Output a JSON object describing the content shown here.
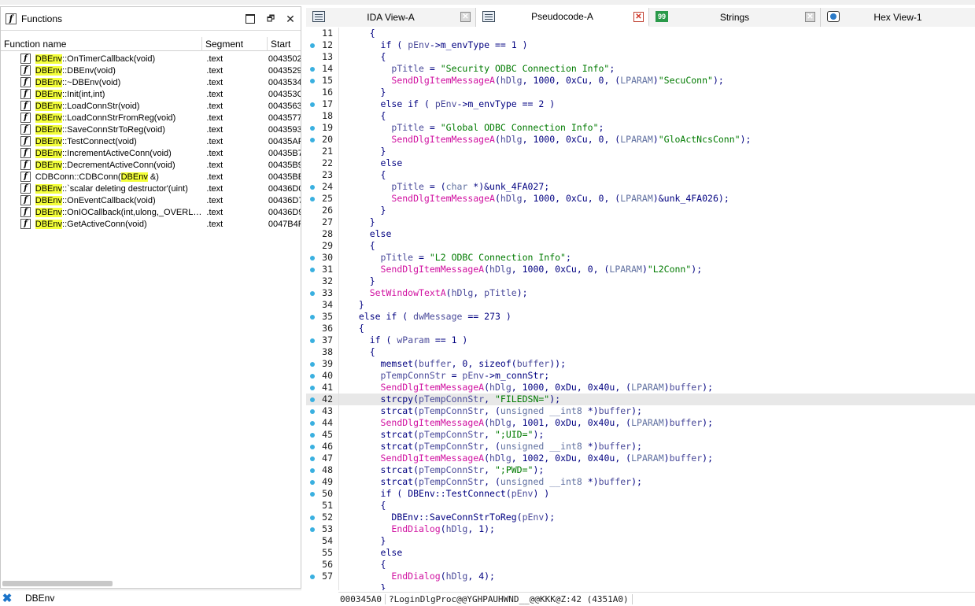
{
  "functions_pane": {
    "title": "Functions",
    "columns": {
      "name": "Function name",
      "segment": "Segment",
      "start": "Start"
    },
    "rows": [
      {
        "pre": "",
        "hl": "DBEnv",
        "post": "::OnTimerCallback(void)",
        "segment": ".text",
        "start": "0043502"
      },
      {
        "pre": "",
        "hl": "DBEnv",
        "post": "::DBEnv(void)",
        "segment": ".text",
        "start": "0043529"
      },
      {
        "pre": "",
        "hl": "DBEnv",
        "post": "::~DBEnv(void)",
        "segment": ".text",
        "start": "0043534"
      },
      {
        "pre": "",
        "hl": "DBEnv",
        "post": "::Init(int,int)",
        "segment": ".text",
        "start": "004353C"
      },
      {
        "pre": "",
        "hl": "DBEnv",
        "post": "::LoadConnStr(void)",
        "segment": ".text",
        "start": "0043563"
      },
      {
        "pre": "",
        "hl": "DBEnv",
        "post": "::LoadConnStrFromReg(void)",
        "segment": ".text",
        "start": "0043577"
      },
      {
        "pre": "",
        "hl": "DBEnv",
        "post": "::SaveConnStrToReg(void)",
        "segment": ".text",
        "start": "0043593"
      },
      {
        "pre": "",
        "hl": "DBEnv",
        "post": "::TestConnect(void)",
        "segment": ".text",
        "start": "00435AF"
      },
      {
        "pre": "",
        "hl": "DBEnv",
        "post": "::IncrementActiveConn(void)",
        "segment": ".text",
        "start": "00435B7"
      },
      {
        "pre": "",
        "hl": "DBEnv",
        "post": "::DecrementActiveConn(void)",
        "segment": ".text",
        "start": "00435B9"
      },
      {
        "pre": "CDBConn::CDBConn(",
        "hl": "DBEnv",
        "post": " &)",
        "segment": ".text",
        "start": "00435BE"
      },
      {
        "pre": "",
        "hl": "DBEnv",
        "post": "::`scalar deleting destructor'(uint)",
        "segment": ".text",
        "start": "00436D0"
      },
      {
        "pre": "",
        "hl": "DBEnv",
        "post": "::OnEventCallback(void)",
        "segment": ".text",
        "start": "00436D7"
      },
      {
        "pre": "",
        "hl": "DBEnv",
        "post": "::OnIOCallback(int,ulong,_OVERLAPPED *)",
        "segment": ".text",
        "start": "00436D9"
      },
      {
        "pre": "",
        "hl": "DBEnv",
        "post": "::GetActiveConn(void)",
        "segment": ".text",
        "start": "0047B4F"
      }
    ],
    "filter_text": "DBEnv"
  },
  "tabs": [
    {
      "label": "IDA View-A",
      "icon": "disassembly-view-icon",
      "active": false
    },
    {
      "label": "Pseudocode-A",
      "icon": "pseudocode-view-icon",
      "active": true
    },
    {
      "label": "Strings",
      "icon": "strings-view-icon",
      "active": false
    },
    {
      "label": "Hex View-1",
      "icon": "hex-view-icon",
      "active": false
    }
  ],
  "code": {
    "first_line": 11,
    "current_line": 42,
    "lines": [
      {
        "no": "11",
        "dot": false,
        "text": "    {"
      },
      {
        "no": "12",
        "dot": true,
        "text": "      if ( pEnv->m_envType == 1 )"
      },
      {
        "no": "13",
        "dot": false,
        "text": "      {"
      },
      {
        "no": "14",
        "dot": true,
        "text": "        pTitle = \"Security ODBC Connection Info\";"
      },
      {
        "no": "15",
        "dot": true,
        "text": "        SendDlgItemMessageA(hDlg, 1000, 0xCu, 0, (LPARAM)\"SecuConn\");"
      },
      {
        "no": "16",
        "dot": false,
        "text": "      }"
      },
      {
        "no": "17",
        "dot": true,
        "text": "      else if ( pEnv->m_envType == 2 )"
      },
      {
        "no": "18",
        "dot": false,
        "text": "      {"
      },
      {
        "no": "19",
        "dot": true,
        "text": "        pTitle = \"Global ODBC Connection Info\";"
      },
      {
        "no": "20",
        "dot": true,
        "text": "        SendDlgItemMessageA(hDlg, 1000, 0xCu, 0, (LPARAM)\"GloActNcsConn\");"
      },
      {
        "no": "21",
        "dot": false,
        "text": "      }"
      },
      {
        "no": "22",
        "dot": false,
        "text": "      else"
      },
      {
        "no": "23",
        "dot": false,
        "text": "      {"
      },
      {
        "no": "24",
        "dot": true,
        "text": "        pTitle = (char *)&unk_4FA027;"
      },
      {
        "no": "25",
        "dot": true,
        "text": "        SendDlgItemMessageA(hDlg, 1000, 0xCu, 0, (LPARAM)&unk_4FA026);"
      },
      {
        "no": "26",
        "dot": false,
        "text": "      }"
      },
      {
        "no": "27",
        "dot": false,
        "text": "    }"
      },
      {
        "no": "28",
        "dot": false,
        "text": "    else"
      },
      {
        "no": "29",
        "dot": false,
        "text": "    {"
      },
      {
        "no": "30",
        "dot": true,
        "text": "      pTitle = \"L2 ODBC Connection Info\";"
      },
      {
        "no": "31",
        "dot": true,
        "text": "      SendDlgItemMessageA(hDlg, 1000, 0xCu, 0, (LPARAM)\"L2Conn\");"
      },
      {
        "no": "32",
        "dot": false,
        "text": "    }"
      },
      {
        "no": "33",
        "dot": true,
        "text": "    SetWindowTextA(hDlg, pTitle);"
      },
      {
        "no": "34",
        "dot": false,
        "text": "  }"
      },
      {
        "no": "35",
        "dot": true,
        "text": "  else if ( dwMessage == 273 )"
      },
      {
        "no": "36",
        "dot": false,
        "text": "  {"
      },
      {
        "no": "37",
        "dot": true,
        "text": "    if ( wParam == 1 )"
      },
      {
        "no": "38",
        "dot": false,
        "text": "    {"
      },
      {
        "no": "39",
        "dot": true,
        "text": "      memset(buffer, 0, sizeof(buffer));"
      },
      {
        "no": "40",
        "dot": true,
        "text": "      pTempConnStr = pEnv->m_connStr;"
      },
      {
        "no": "41",
        "dot": true,
        "text": "      SendDlgItemMessageA(hDlg, 1000, 0xDu, 0x40u, (LPARAM)buffer);"
      },
      {
        "no": "42",
        "dot": true,
        "text": "      strcpy(pTempConnStr, \"FILEDSN=\");"
      },
      {
        "no": "43",
        "dot": true,
        "text": "      strcat(pTempConnStr, (unsigned __int8 *)buffer);"
      },
      {
        "no": "44",
        "dot": true,
        "text": "      SendDlgItemMessageA(hDlg, 1001, 0xDu, 0x40u, (LPARAM)buffer);"
      },
      {
        "no": "45",
        "dot": true,
        "text": "      strcat(pTempConnStr, \";UID=\");"
      },
      {
        "no": "46",
        "dot": true,
        "text": "      strcat(pTempConnStr, (unsigned __int8 *)buffer);"
      },
      {
        "no": "47",
        "dot": true,
        "text": "      SendDlgItemMessageA(hDlg, 1002, 0xDu, 0x40u, (LPARAM)buffer);"
      },
      {
        "no": "48",
        "dot": true,
        "text": "      strcat(pTempConnStr, \";PWD=\");"
      },
      {
        "no": "49",
        "dot": true,
        "text": "      strcat(pTempConnStr, (unsigned __int8 *)buffer);"
      },
      {
        "no": "50",
        "dot": true,
        "text": "      if ( DBEnv::TestConnect(pEnv) )"
      },
      {
        "no": "51",
        "dot": false,
        "text": "      {"
      },
      {
        "no": "52",
        "dot": true,
        "text": "        DBEnv::SaveConnStrToReg(pEnv);"
      },
      {
        "no": "53",
        "dot": true,
        "text": "        EndDialog(hDlg, 1);"
      },
      {
        "no": "54",
        "dot": false,
        "text": "      }"
      },
      {
        "no": "55",
        "dot": false,
        "text": "      else"
      },
      {
        "no": "56",
        "dot": false,
        "text": "      {"
      },
      {
        "no": "57",
        "dot": true,
        "text": "        EndDialog(hDlg, 4);"
      },
      {
        "no": "",
        "dot": false,
        "text": "      }"
      }
    ]
  },
  "status": {
    "address": "000345A0",
    "location": "?LoginDlgProc@@YGHPAUHWND__@@KKK@Z:42 (4351A0)"
  },
  "colors": {
    "highlight": "#f4ff3a",
    "function_call": "#d010a0",
    "string": "#007a00",
    "keyword": "#000080",
    "line_dot": "#3ab0e0"
  }
}
